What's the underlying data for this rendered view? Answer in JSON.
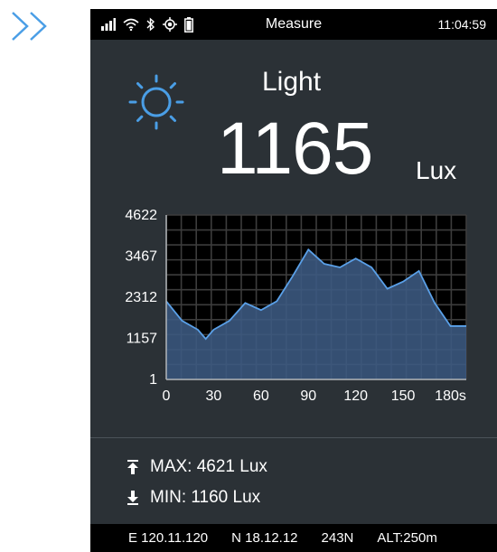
{
  "status_bar": {
    "title": "Measure",
    "time": "11:04:59",
    "icons": [
      "signal-icon",
      "wifi-icon",
      "bluetooth-icon",
      "gps-icon",
      "battery-icon"
    ]
  },
  "reading": {
    "label": "Light",
    "value": "1165",
    "unit": "Lux",
    "icon": "sun-icon",
    "icon_color": "#4a9ee6"
  },
  "stats": {
    "max_label": "MAX:",
    "max_value": "4621 Lux",
    "min_label": "MIN:",
    "min_value": "1160 Lux"
  },
  "footer": {
    "longitude": "E 120.11.120",
    "latitude": "N 18.12.12",
    "heading": "243N",
    "altitude": "ALT:250m"
  },
  "colors": {
    "accent": "#4a9ee6",
    "panel_bg": "#2b3136",
    "chart_fill": "#3c5a82",
    "chart_line": "#5aa0e8"
  },
  "chart_data": {
    "type": "area",
    "x": [
      0,
      10,
      20,
      25,
      30,
      40,
      50,
      60,
      70,
      80,
      90,
      100,
      110,
      120,
      130,
      140,
      150,
      160,
      170,
      180,
      190
    ],
    "values": [
      2200,
      1650,
      1400,
      1140,
      1400,
      1650,
      2150,
      1950,
      2200,
      2900,
      3650,
      3250,
      3150,
      3400,
      3150,
      2550,
      2750,
      3050,
      2150,
      1500,
      1500
    ],
    "y_ticks": [
      "4622",
      "3467",
      "2312",
      "1157",
      "1"
    ],
    "x_ticks": [
      "0",
      "30",
      "60",
      "90",
      "120",
      "150",
      "180s"
    ],
    "ylim": [
      1,
      4622
    ],
    "xlim": [
      0,
      190
    ],
    "grid": true
  }
}
